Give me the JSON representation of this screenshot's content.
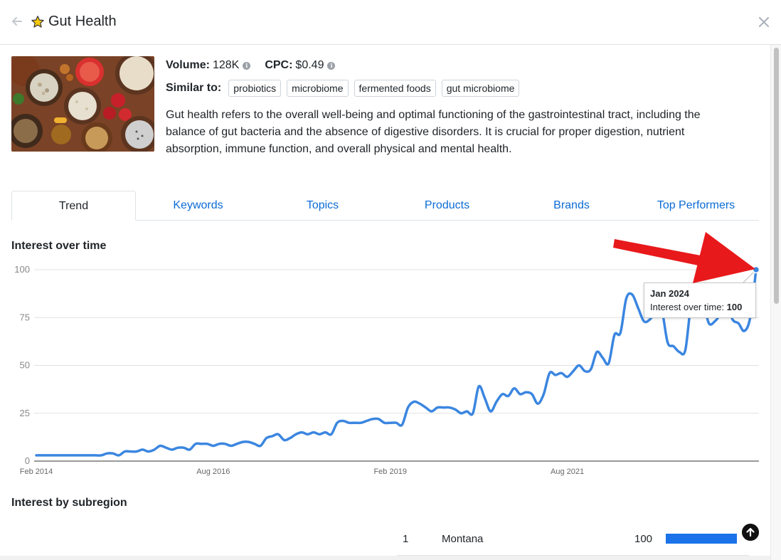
{
  "header": {
    "title": "Gut Health",
    "close_label": "×"
  },
  "stats": {
    "volume_label": "Volume:",
    "volume_value": "128K",
    "cpc_label": "CPC:",
    "cpc_value": "$0.49"
  },
  "similar": {
    "label": "Similar to:",
    "chips": [
      "probiotics",
      "microbiome",
      "fermented foods",
      "gut microbiome"
    ]
  },
  "description": "Gut health refers to the overall well-being and optimal functioning of the gastrointestinal tract, including the balance of gut bacteria and the absence of digestive disorders. It is crucial for proper digestion, nutrient absorption, immune function, and overall physical and mental health.",
  "tabs": [
    "Trend",
    "Keywords",
    "Topics",
    "Products",
    "Brands",
    "Top Performers"
  ],
  "active_tab": "Trend",
  "sections": {
    "interest_over_time": "Interest over time",
    "interest_by_subregion": "Interest by subregion"
  },
  "tooltip": {
    "date": "Jan 2024",
    "label": "Interest over time:",
    "value": "100"
  },
  "subregion": [
    {
      "rank": "1",
      "name": "Montana",
      "value": "100",
      "share": 1.0
    }
  ],
  "colors": {
    "accent": "#0b6bd6",
    "line": "#3b86e0",
    "bar": "#1a73e8",
    "annotation_arrow": "#e8191b"
  },
  "chart_data": {
    "type": "line",
    "title": "",
    "xlabel": "",
    "ylabel": "",
    "ylim": [
      0,
      100
    ],
    "yticks": [
      0,
      25,
      50,
      75,
      100
    ],
    "grid": true,
    "x_tick_labels": [
      "Feb 2014",
      "Aug 2016",
      "Feb 2019",
      "Aug 2021"
    ],
    "x_start": "Feb 2014",
    "x_end": "Jan 2024",
    "series": [
      {
        "values": [
          3,
          3,
          3,
          3,
          3,
          3,
          3,
          3,
          3,
          3,
          3,
          3,
          4,
          4,
          3,
          5,
          5,
          5,
          6,
          5,
          6,
          8,
          7,
          6,
          7,
          7,
          6,
          9,
          9,
          9,
          8,
          9,
          9,
          8,
          9,
          10,
          10,
          9,
          8,
          12,
          13,
          14,
          11,
          12,
          14,
          15,
          14,
          15,
          14,
          15,
          14,
          20,
          21,
          20,
          20,
          20,
          21,
          22,
          22,
          20,
          20,
          20,
          19,
          28,
          31,
          30,
          28,
          26,
          28,
          28,
          28,
          27,
          25,
          26,
          25,
          39,
          33,
          26,
          31,
          35,
          34,
          38,
          35,
          36,
          35,
          30,
          35,
          46,
          45,
          46,
          44,
          47,
          50,
          47,
          48,
          57,
          54,
          51,
          66,
          67,
          85,
          87,
          80,
          73,
          74,
          78,
          79,
          62,
          60,
          57,
          58,
          82,
          85,
          83,
          72,
          73,
          77,
          83,
          74,
          72,
          68,
          75,
          100
        ]
      }
    ]
  }
}
